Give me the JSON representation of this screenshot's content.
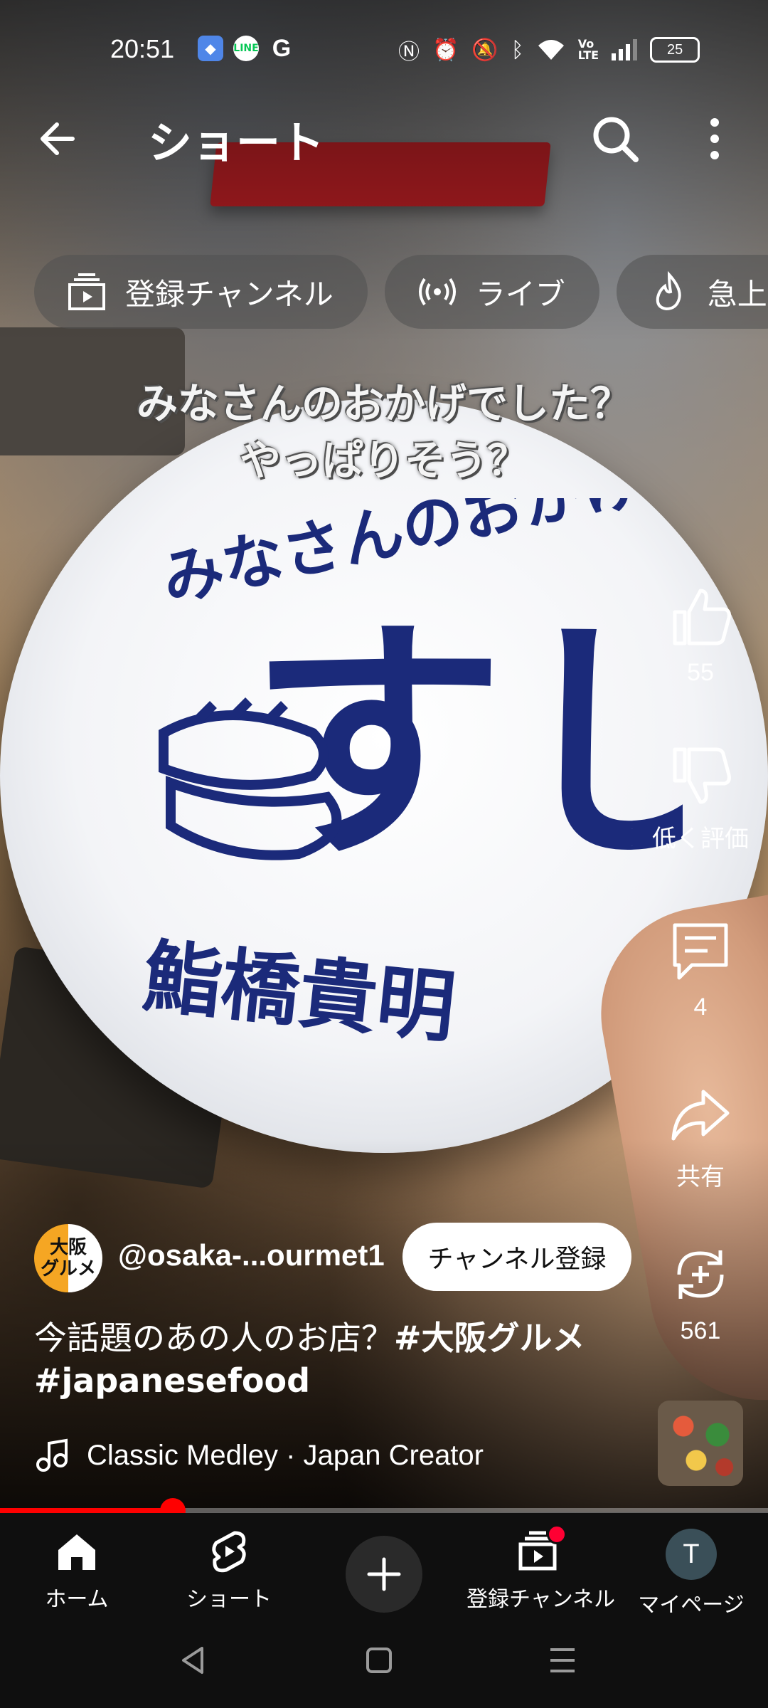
{
  "status_bar": {
    "time": "20:51",
    "left_icons": [
      "maps-icon",
      "line-icon",
      "google-icon"
    ],
    "right_icons": [
      "nfc-icon",
      "alarm-icon",
      "mute-icon",
      "bluetooth-icon",
      "wifi-icon",
      "volte-icon",
      "signal-icon"
    ],
    "battery": "25"
  },
  "app_bar": {
    "title": "ショート"
  },
  "chips": [
    {
      "label": "登録チャンネル",
      "icon": "subscriptions-icon"
    },
    {
      "label": "ライブ",
      "icon": "live-icon"
    },
    {
      "label": "急上",
      "icon": "trending-icon"
    }
  ],
  "video": {
    "overlay_caption_line1": "みなさんのおかげでした？",
    "overlay_caption_line2": "やっぱりそう？",
    "plate_text_small": "みなさんのおかげで",
    "plate_text_big": "すし",
    "plate_text_name": "鮨橋貴明"
  },
  "actions": {
    "like_count": "55",
    "dislike_label": "低く評価",
    "comment_count": "4",
    "share_label": "共有",
    "remix_count": "561"
  },
  "channel": {
    "avatar_text_line1": "大阪",
    "avatar_text_line2": "グルメ",
    "handle": "@osaka-...ourmet1",
    "subscribe_label": "チャンネル登録"
  },
  "description": {
    "text": "今話題のあの人のお店？",
    "hashtag1": "#大阪グルメ",
    "hashtag2": "#japanesefood"
  },
  "music": {
    "label": "Classic Medley · Japan Creator"
  },
  "progress": {
    "fraction": 0.225
  },
  "bottom_nav": {
    "home": "ホーム",
    "shorts": "ショート",
    "subscriptions": "登録チャンネル",
    "mypage": "マイページ",
    "avatar_letter": "T"
  },
  "colors": {
    "accent": "#ff0000",
    "background": "#0f0f0f"
  }
}
